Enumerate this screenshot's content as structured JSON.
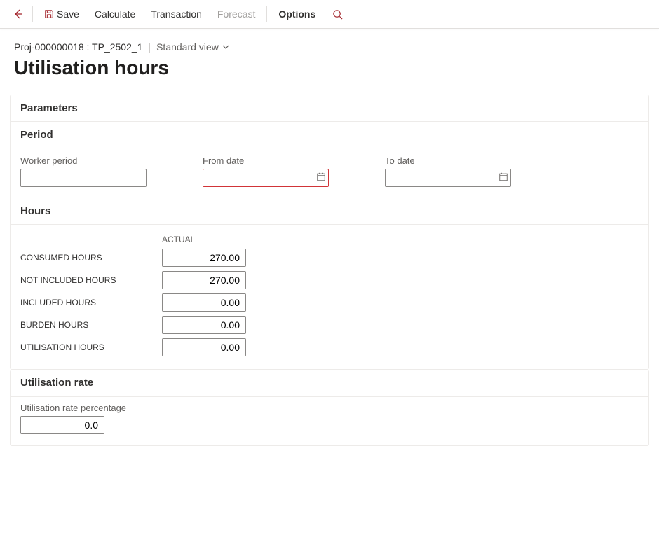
{
  "toolbar": {
    "save_label": "Save",
    "calculate_label": "Calculate",
    "transaction_label": "Transaction",
    "forecast_label": "Forecast",
    "options_label": "Options"
  },
  "breadcrumb": {
    "project_id": "Proj-000000018 : TP_2502_1",
    "view_label": "Standard view"
  },
  "page": {
    "title": "Utilisation hours"
  },
  "parameters": {
    "header": "Parameters"
  },
  "period": {
    "header": "Period",
    "worker_period_label": "Worker period",
    "worker_period_value": "",
    "from_date_label": "From date",
    "from_date_value": "",
    "to_date_label": "To date",
    "to_date_value": ""
  },
  "hours": {
    "header": "Hours",
    "column_label": "ACTUAL",
    "rows": [
      {
        "label": "CONSUMED HOURS",
        "value": "270.00"
      },
      {
        "label": "NOT INCLUDED HOURS",
        "value": "270.00"
      },
      {
        "label": "INCLUDED HOURS",
        "value": "0.00"
      },
      {
        "label": "BURDEN HOURS",
        "value": "0.00"
      },
      {
        "label": "UTILISATION HOURS",
        "value": "0.00"
      }
    ]
  },
  "rate": {
    "header": "Utilisation rate",
    "label": "Utilisation rate percentage",
    "value": "0.0"
  }
}
